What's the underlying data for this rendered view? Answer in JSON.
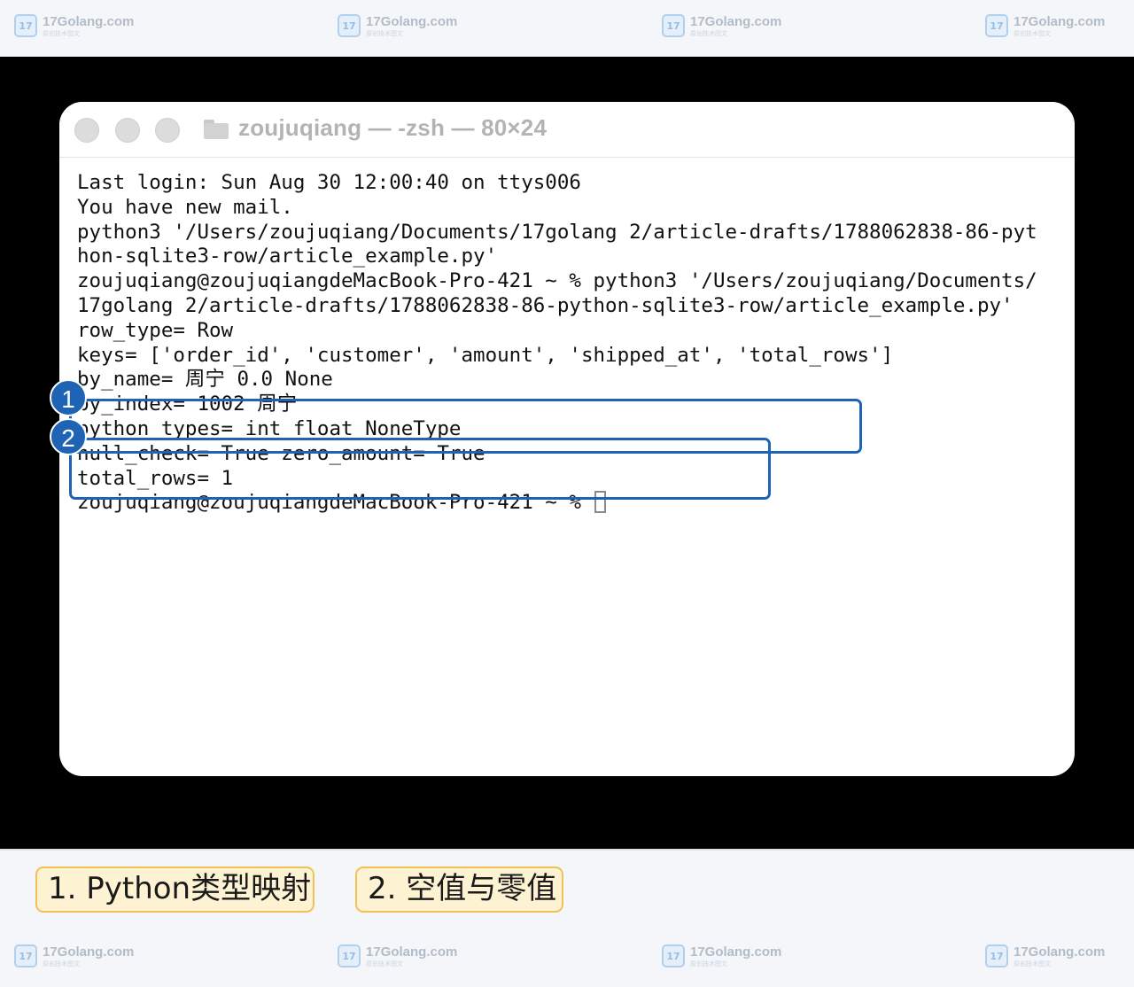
{
  "watermark": {
    "brand": "17Golang.com",
    "tagline": "原创技术图文",
    "logo": "17"
  },
  "window": {
    "title": "zoujuqiang — -zsh — 80×24",
    "folder_icon": "folder-icon"
  },
  "terminal": {
    "lines": [
      "Last login: Sun Aug 30 12:00:40 on ttys006",
      "You have new mail.",
      "python3 '/Users/zoujuqiang/Documents/17golang 2/article-drafts/1788062838-86-pyt",
      "hon-sqlite3-row/article_example.py'",
      "zoujuqiang@zoujuqiangdeMacBook-Pro-421 ~ % python3 '/Users/zoujuqiang/Documents/",
      "17golang 2/article-drafts/1788062838-86-python-sqlite3-row/article_example.py'",
      "row_type= Row",
      "keys= ['order_id', 'customer', 'amount', 'shipped_at', 'total_rows']",
      "by_name= 周宁 0.0 None",
      "by_index= 1002 周宁",
      "python_types= int float NoneType",
      "null_check= True zero_amount= True",
      "total_rows= 1"
    ],
    "prompt": "zoujuqiang@zoujuqiangdeMacBook-Pro-421 ~ % "
  },
  "markers": {
    "m1": "1",
    "m2": "2"
  },
  "legend": {
    "item1": "1. Python类型映射",
    "item2": "2. 空值与零值"
  },
  "colors": {
    "highlight": "#1f63b5",
    "pill_bg": "#fdf3d3",
    "pill_border": "#f0c255"
  }
}
